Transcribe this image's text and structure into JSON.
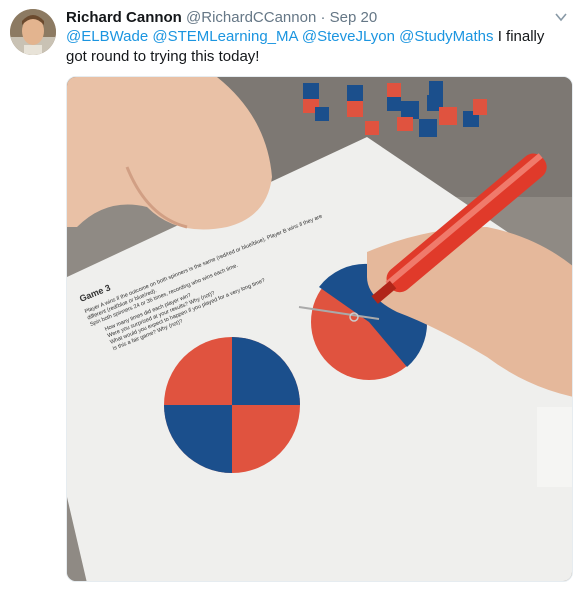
{
  "tweet": {
    "author_name": "Richard Cannon",
    "handle": "@RichardCCannon",
    "separator": "·",
    "date": "Sep 20",
    "mentions": [
      "@ELBWade",
      "@STEMLearning_MA",
      "@SteveJLyon",
      "@StudyMaths"
    ],
    "body_text": "I finally got round to trying this today!"
  },
  "photo": {
    "worksheet": {
      "title": "Game 3",
      "rules_line1": "Player A wins if the outcome on both spinners is the same (red/red or blue/blue). Player B wins if they are",
      "rules_line2": "different (red/blue or blue/red).",
      "rules_line3": "Spin both spinners 24 or 36 times, recording who wins each time.",
      "questions": [
        "How many times did each player win?",
        "Were you surprised at your results?  Why (not)?",
        "What would you expect to happen if you played for a very long time?",
        "Is this a fair game?  Why (not)?"
      ]
    },
    "colors": {
      "red": "#e0533f",
      "blue": "#1b4f8c"
    }
  },
  "icons": {
    "caret": "chevron-down-icon"
  }
}
